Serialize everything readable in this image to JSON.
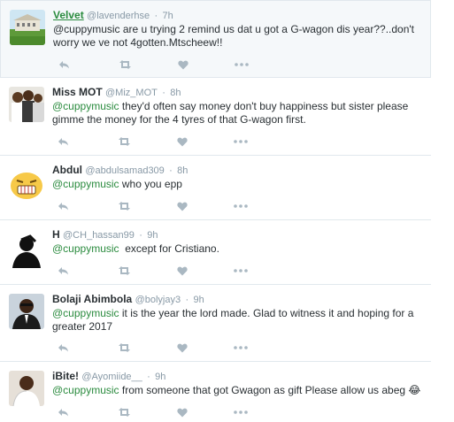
{
  "tweets": [
    {
      "name": "Velvet",
      "handle": "@lavenderhse",
      "separator": "·",
      "time": "7h",
      "mention": "",
      "text": "@cuppymusic are u trying 2 remind us dat u got a G-wagon dis year??..don't worry we ve not 4gotten.Mtscheew!!",
      "avatar": "landscape-avatar"
    },
    {
      "name": "Miss MOT",
      "handle": "@Miz_MOT",
      "separator": "·",
      "time": "8h",
      "mention": "@cuppymusic",
      "text": " they'd often say money don't buy happiness but sister please gimme the money for the 4 tyres of that G-wagon first.",
      "avatar": "group-avatar"
    },
    {
      "name": "Abdul",
      "handle": "@abdulsamad309",
      "separator": "·",
      "time": "8h",
      "mention": "@cuppymusic",
      "text": " who you epp",
      "avatar": "grimace-emoji-avatar"
    },
    {
      "name": "H",
      "handle": "@CH_hassan99",
      "separator": "·",
      "time": "9h",
      "mention": "@cuppymusic",
      "text": "  except for Cristiano.",
      "avatar": "silhouette-avatar"
    },
    {
      "name": "Bolaji Abimbola",
      "handle": "@bolyjay3",
      "separator": "·",
      "time": "9h",
      "mention": "@cuppymusic",
      "text": " it is the year the lord made. Glad to witness it and hoping for a greater 2017",
      "avatar": "suit-avatar"
    },
    {
      "name": "iBite!",
      "handle": "@Ayomiide__",
      "separator": "·",
      "time": "9h",
      "mention": "@cuppymusic",
      "text": " from someone that got Gwagon as gift Please allow us abeg 😂",
      "avatar": "portrait-avatar"
    }
  ],
  "colors": {
    "accent": "#2a8b3e",
    "icon": "#aab8c2",
    "muted": "#8899a6",
    "border": "#e1e8ed"
  },
  "actions": [
    "reply-icon",
    "retweet-icon",
    "like-icon",
    "more-icon"
  ]
}
